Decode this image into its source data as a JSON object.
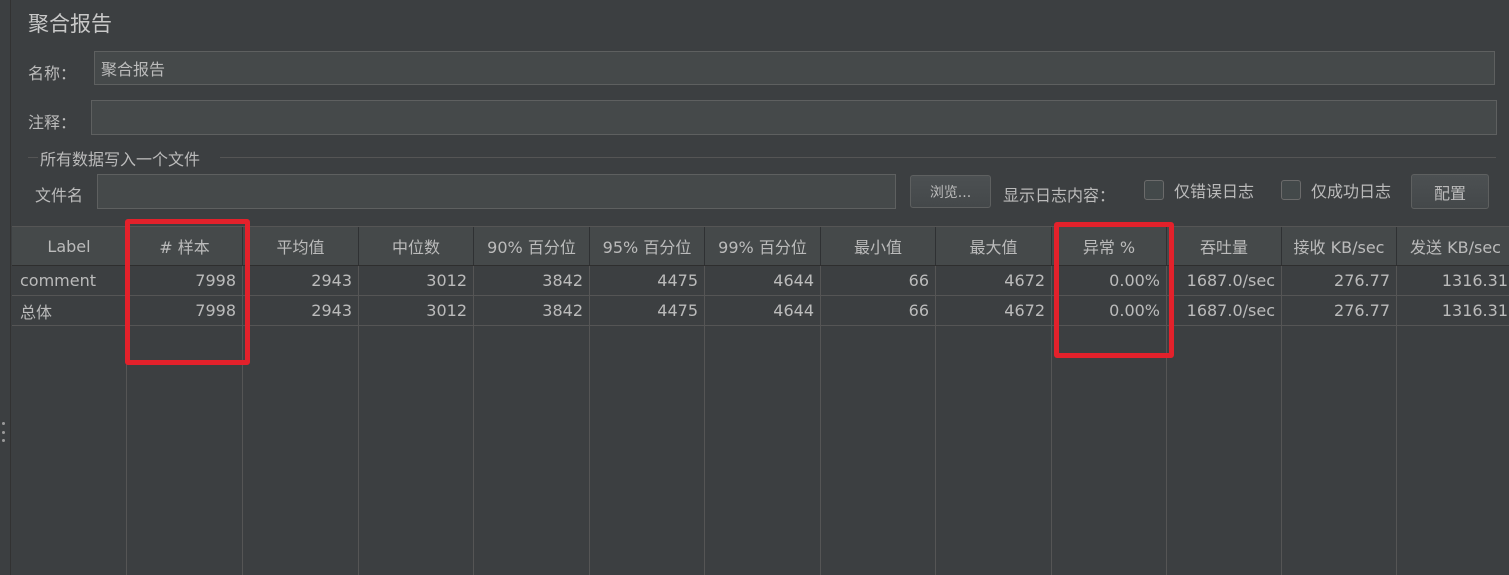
{
  "panel": {
    "title": "聚合报告",
    "name_label": "名称：",
    "name_value": "聚合报告",
    "comment_label": "注释：",
    "comment_value": ""
  },
  "file_section": {
    "group_title": "所有数据写入一个文件",
    "filename_label": "文件名",
    "filename_value": "",
    "browse_button": "浏览...",
    "log_content_label": "显示日志内容：",
    "errors_only_label": "仅错误日志",
    "successes_only_label": "仅成功日志",
    "config_button": "配置"
  },
  "table": {
    "columns": [
      "Label",
      "# 样本",
      "平均值",
      "中位数",
      "90% 百分位",
      "95% 百分位",
      "99% 百分位",
      "最小值",
      "最大值",
      "异常 %",
      "吞吐量",
      "接收 KB/sec",
      "发送 KB/sec"
    ],
    "rows": [
      [
        "comment",
        "7998",
        "2943",
        "3012",
        "3842",
        "4475",
        "4644",
        "66",
        "4672",
        "0.00%",
        "1687.0/sec",
        "276.77",
        "1316.31"
      ],
      [
        "总体",
        "7998",
        "2943",
        "3012",
        "3842",
        "4475",
        "4644",
        "66",
        "4672",
        "0.00%",
        "1687.0/sec",
        "276.77",
        "1316.31"
      ]
    ]
  },
  "colors": {
    "background": "#3c3f41",
    "highlight": "#e3212b"
  }
}
